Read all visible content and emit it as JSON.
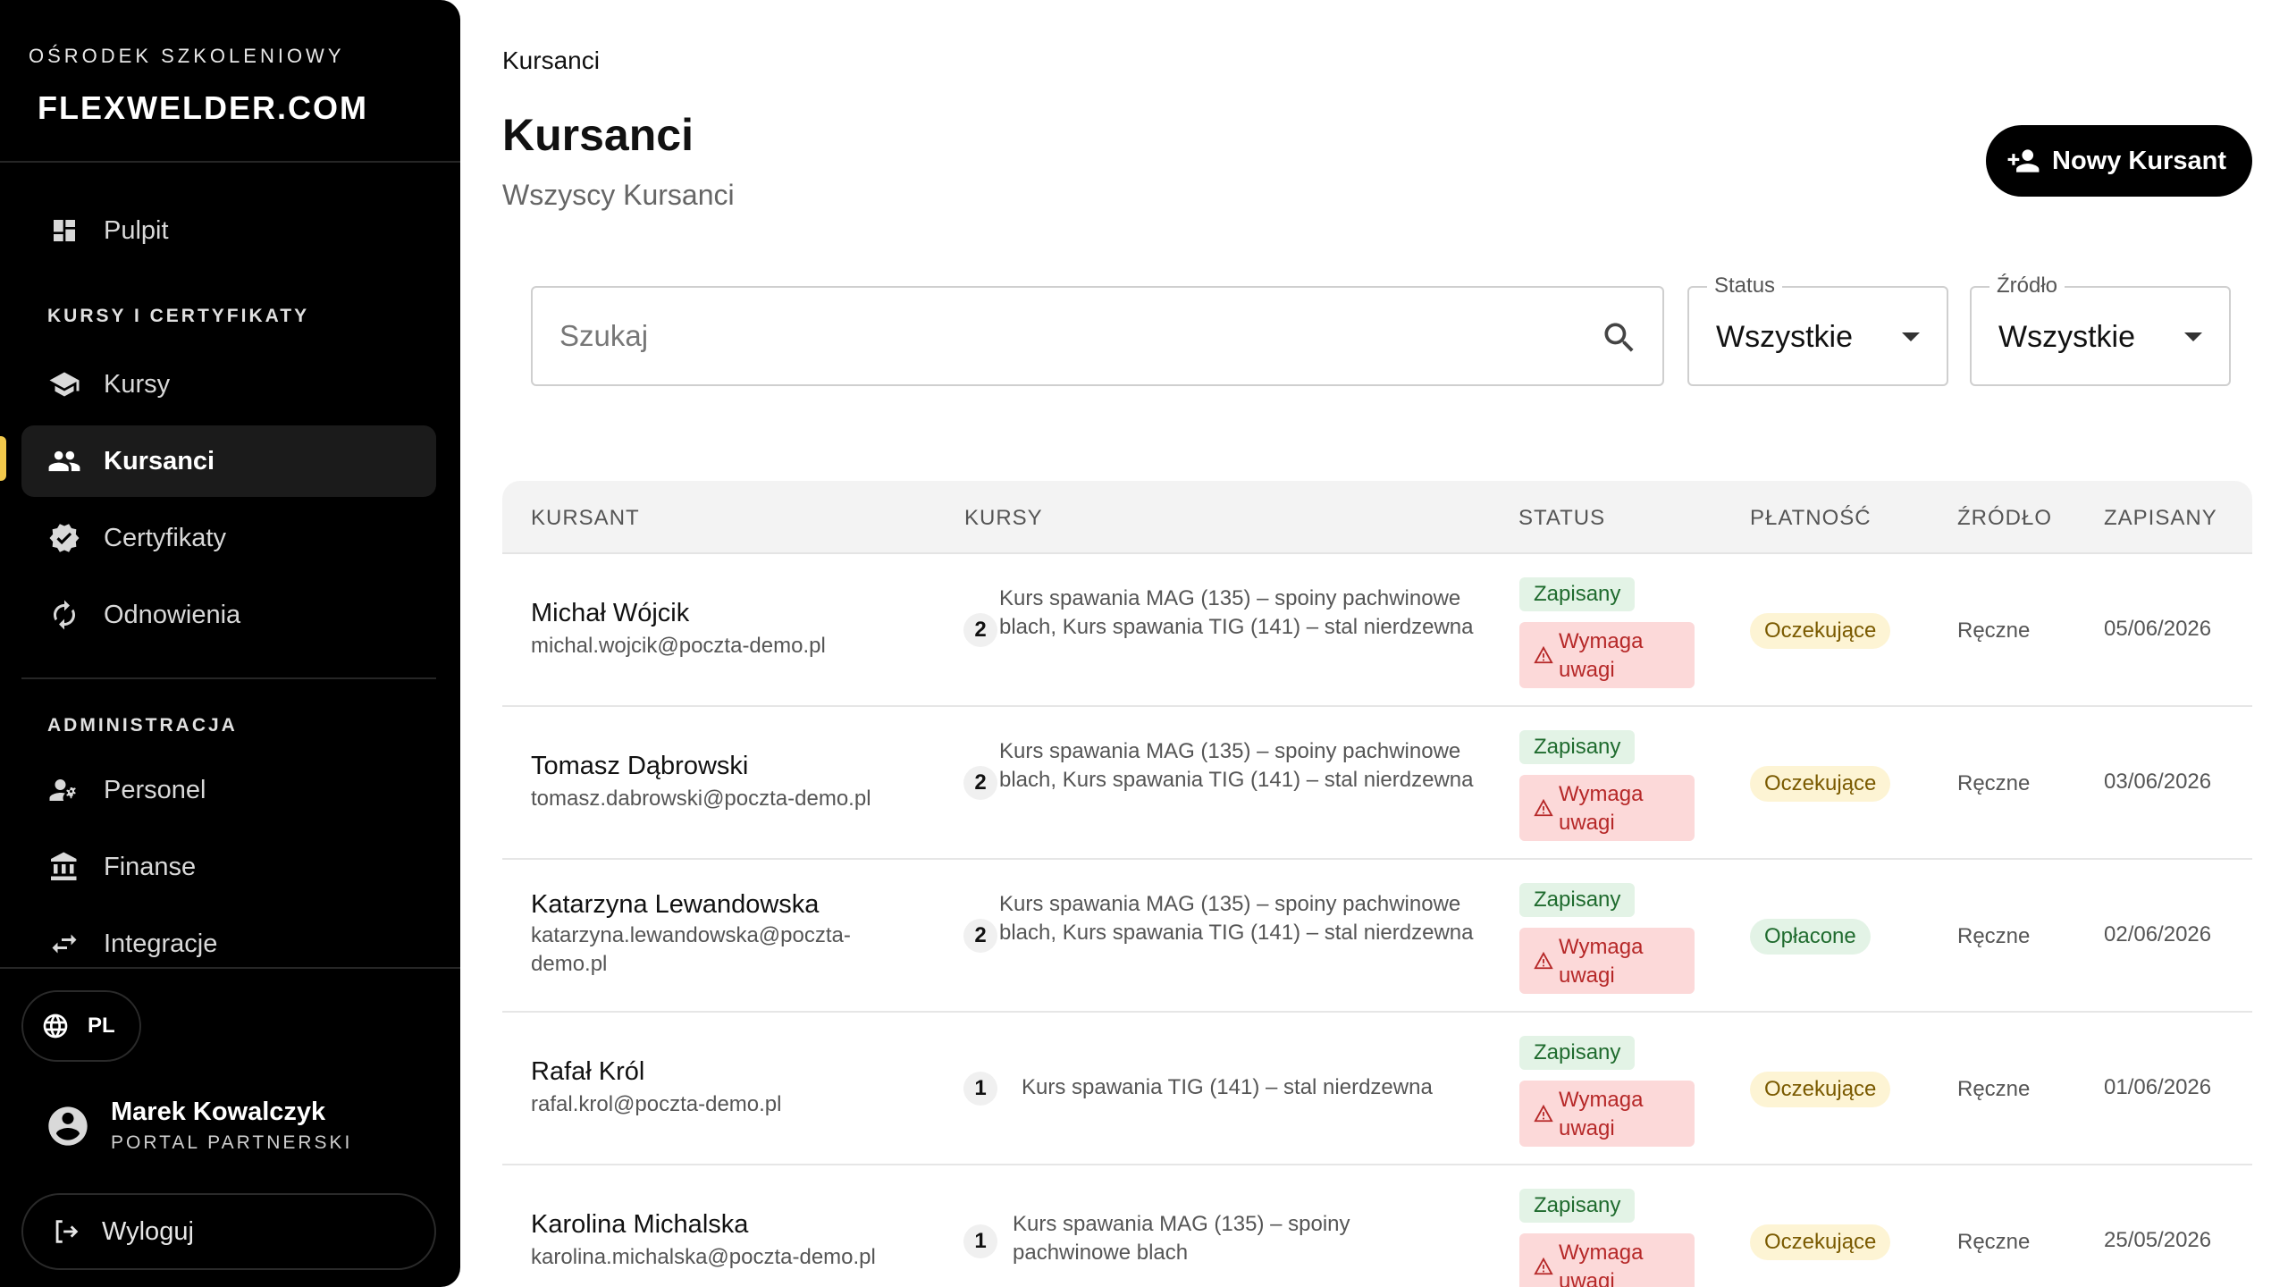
{
  "sidebar": {
    "brand_subtitle": "OŚRODEK SZKOLENIOWY",
    "brand_logo": "FLEXWELDER.COM",
    "nav_dashboard": "Pulpit",
    "section_courses": "KURSY I CERTYFIKATY",
    "nav_courses": "Kursy",
    "nav_students": "Kursanci",
    "nav_certificates": "Certyfikaty",
    "nav_renewals": "Odnowienia",
    "section_admin": "ADMINISTRACJA",
    "nav_staff": "Personel",
    "nav_finance": "Finanse",
    "nav_integrations": "Integracje",
    "language": "PL",
    "user_name": "Marek Kowalczyk",
    "user_role": "PORTAL PARTNERSKI",
    "logout": "Wyloguj",
    "accent_color": "#f2c94c"
  },
  "header": {
    "breadcrumb": "Kursanci",
    "title": "Kursanci",
    "subtitle": "Wszyscy Kursanci",
    "new_button": "Nowy Kursant"
  },
  "filters": {
    "search_placeholder": "Szukaj",
    "status_label": "Status",
    "status_value": "Wszystkie",
    "source_label": "Źródło",
    "source_value": "Wszystkie"
  },
  "table": {
    "columns": {
      "student": "KURSANT",
      "courses": "KURSY",
      "status": "STATUS",
      "payment": "PŁATNOŚĆ",
      "source": "ŹRÓDŁO",
      "enrolled": "ZAPISANY"
    },
    "rows": [
      {
        "name": "Michał Wójcik",
        "email": "michal.wojcik@poczta-demo.pl",
        "course_count": "2",
        "courses": "Kurs spawania MAG (135) – spoiny pachwinowe blach, Kurs spawania TIG (141) – stal nierdzewna",
        "status": "Zapisany",
        "alert": "Wymaga uwagi",
        "payment": "Oczekujące",
        "source": "Ręczne",
        "date": "05/06/2026"
      },
      {
        "name": "Tomasz Dąbrowski",
        "email": "tomasz.dabrowski@poczta-demo.pl",
        "course_count": "2",
        "courses": "Kurs spawania MAG (135) – spoiny pachwinowe blach, Kurs spawania TIG (141) – stal nierdzewna",
        "status": "Zapisany",
        "alert": "Wymaga uwagi",
        "payment": "Oczekujące",
        "source": "Ręczne",
        "date": "03/06/2026"
      },
      {
        "name": "Katarzyna Lewandowska",
        "email": "katarzyna.lewandowska@poczta-demo.pl",
        "course_count": "2",
        "courses": "Kurs spawania MAG (135) – spoiny pachwinowe blach, Kurs spawania TIG (141) – stal nierdzewna",
        "status": "Zapisany",
        "alert": "Wymaga uwagi",
        "payment": "Opłacone",
        "source": "Ręczne",
        "date": "02/06/2026"
      },
      {
        "name": "Rafał Król",
        "email": "rafal.krol@poczta-demo.pl",
        "course_count": "1",
        "courses": "Kurs spawania TIG (141) – stal nierdzewna",
        "status": "Zapisany",
        "alert": "Wymaga uwagi",
        "payment": "Oczekujące",
        "source": "Ręczne",
        "date": "01/06/2026"
      },
      {
        "name": "Karolina Michalska",
        "email": "karolina.michalska@poczta-demo.pl",
        "course_count": "1",
        "courses": "Kurs spawania MAG (135) – spoiny pachwinowe blach",
        "status": "Zapisany",
        "alert": "Wymaga uwagi",
        "payment": "Oczekujące",
        "source": "Ręczne",
        "date": "25/05/2026"
      }
    ]
  }
}
